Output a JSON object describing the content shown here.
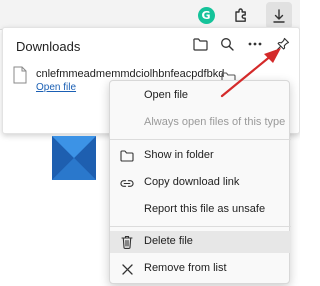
{
  "toolbar": {
    "grammarly_letter": "G"
  },
  "downloads": {
    "title": "Downloads",
    "item": {
      "file_name": "cnlefmmeadmemmdciolhbnfeacpdfbkd",
      "open_link": "Open file"
    }
  },
  "context_menu": {
    "items": [
      {
        "label": "Open file",
        "icon": "",
        "enabled": true
      },
      {
        "label": "Always open files of this type",
        "icon": "",
        "enabled": false
      },
      {
        "label": "Show in folder",
        "icon": "folder-icon",
        "enabled": true
      },
      {
        "label": "Copy download link",
        "icon": "link-icon",
        "enabled": true
      },
      {
        "label": "Report this file as unsafe",
        "icon": "",
        "enabled": true
      },
      {
        "label": "Delete file",
        "icon": "trash-icon",
        "enabled": true,
        "highlighted": true
      },
      {
        "label": "Remove from list",
        "icon": "close-icon",
        "enabled": true
      }
    ]
  },
  "colors": {
    "accent_link": "#1a5fb4",
    "annotation_arrow": "#d42a2a",
    "grammarly": "#15c39a"
  }
}
